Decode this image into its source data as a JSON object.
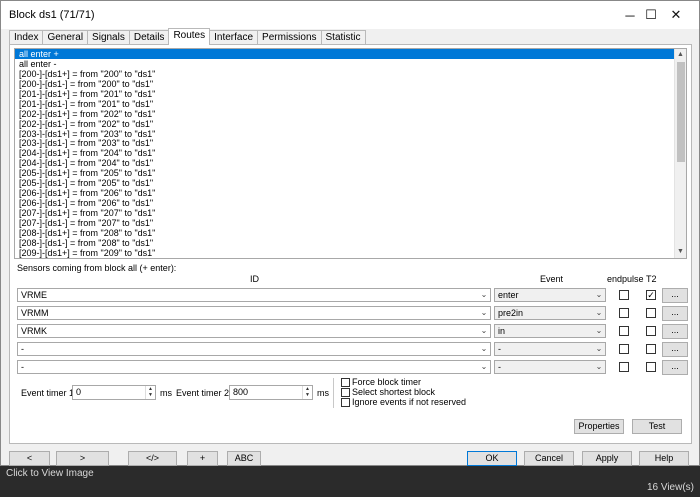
{
  "window": {
    "title": "Block ds1 (71/71)",
    "minimize": "─",
    "maximize": "☐",
    "close": "✕"
  },
  "tabs": [
    {
      "label": "Index"
    },
    {
      "label": "General"
    },
    {
      "label": "Signals"
    },
    {
      "label": "Details"
    },
    {
      "label": "Routes",
      "active": true
    },
    {
      "label": "Interface"
    },
    {
      "label": "Permissions"
    },
    {
      "label": "Statistic"
    }
  ],
  "routes": {
    "items": [
      "all enter +",
      "all enter -",
      "[200-]-[ds1+] = from \"200\" to \"ds1\"",
      "[200-]-[ds1-] = from \"200\" to \"ds1\"",
      "[201-]-[ds1+] = from \"201\" to \"ds1\"",
      "[201-]-[ds1-] = from \"201\" to \"ds1\"",
      "[202-]-[ds1+] = from \"202\" to \"ds1\"",
      "[202-]-[ds1-] = from \"202\" to \"ds1\"",
      "[203-]-[ds1+] = from \"203\" to \"ds1\"",
      "[203-]-[ds1-] = from \"203\" to \"ds1\"",
      "[204-]-[ds1+] = from \"204\" to \"ds1\"",
      "[204-]-[ds1-] = from \"204\" to \"ds1\"",
      "[205-]-[ds1+] = from \"205\" to \"ds1\"",
      "[205-]-[ds1-] = from \"205\" to \"ds1\"",
      "[206-]-[ds1+] = from \"206\" to \"ds1\"",
      "[206-]-[ds1-] = from \"206\" to \"ds1\"",
      "[207-]-[ds1+] = from \"207\" to \"ds1\"",
      "[207-]-[ds1-] = from \"207\" to \"ds1\"",
      "[208-]-[ds1+] = from \"208\" to \"ds1\"",
      "[208-]-[ds1-] = from \"208\" to \"ds1\"",
      "[209-]-[ds1+] = from \"209\" to \"ds1\""
    ],
    "selected_index": 0
  },
  "sensors": {
    "caption": "Sensors coming from block all (+ enter):",
    "col_id": "ID",
    "col_event": "Event",
    "col_endpulse": "endpulse",
    "col_t2": "T2",
    "rows": [
      {
        "id": "VRME",
        "event": "enter",
        "endpulse": false,
        "t2": true,
        "dots": "..."
      },
      {
        "id": "VRMM",
        "event": "pre2in",
        "endpulse": false,
        "t2": false,
        "dots": "..."
      },
      {
        "id": "VRMK",
        "event": "in",
        "endpulse": false,
        "t2": false,
        "dots": "..."
      },
      {
        "id": "-",
        "event": "-",
        "endpulse": false,
        "t2": false,
        "dots": "..."
      },
      {
        "id": "-",
        "event": "-",
        "endpulse": false,
        "t2": false,
        "dots": "..."
      }
    ]
  },
  "timers": {
    "t1_label": "Event timer 1",
    "t1_value": "0",
    "t1_unit": "ms",
    "t2_label": "Event timer 2",
    "t2_value": "800",
    "t2_unit": "ms"
  },
  "options": {
    "force_block_timer": "Force block timer",
    "select_shortest_block": "Select shortest block",
    "ignore_events": "Ignore events if not reserved"
  },
  "actions": {
    "properties": "Properties",
    "test": "Test"
  },
  "bottom": {
    "prev": "<",
    "next": ">",
    "code": "</>",
    "plus": "+",
    "abc": "ABC",
    "ok": "OK",
    "cancel": "Cancel",
    "apply": "Apply",
    "help": "Help"
  },
  "status": {
    "left": "Click to View Image",
    "right": "16 View(s)"
  }
}
